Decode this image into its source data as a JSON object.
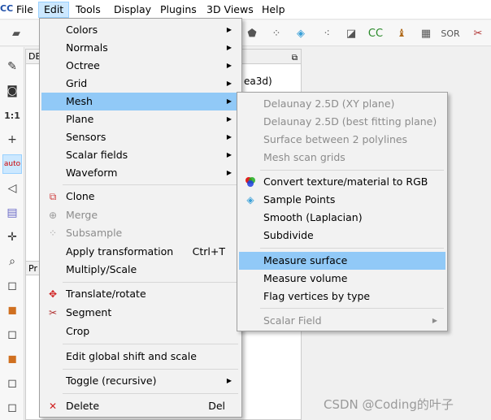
{
  "menubar": {
    "logo": "CC",
    "items": [
      "File",
      "Edit",
      "Tools",
      "Display",
      "Plugins",
      "3D Views",
      "Help"
    ]
  },
  "panel": {
    "db_title": "DB",
    "tree_fragment": "ea3d)",
    "props_title": "Pr"
  },
  "edit_menu": {
    "items": [
      {
        "label": "Colors"
      },
      {
        "label": "Normals"
      },
      {
        "label": "Octree"
      },
      {
        "label": "Grid"
      },
      {
        "label": "Mesh"
      },
      {
        "label": "Plane"
      },
      {
        "label": "Sensors"
      },
      {
        "label": "Scalar fields"
      },
      {
        "label": "Waveform"
      },
      {
        "label": "Clone"
      },
      {
        "label": "Merge"
      },
      {
        "label": "Subsample"
      },
      {
        "label": "Apply transformation",
        "shortcut": "Ctrl+T"
      },
      {
        "label": "Multiply/Scale"
      },
      {
        "label": "Translate/rotate"
      },
      {
        "label": "Segment"
      },
      {
        "label": "Crop"
      },
      {
        "label": "Edit global shift and scale"
      },
      {
        "label": "Toggle (recursive)"
      },
      {
        "label": "Delete",
        "shortcut": "Del"
      }
    ]
  },
  "mesh_menu": {
    "items": [
      {
        "label": "Delaunay 2.5D (XY plane)"
      },
      {
        "label": "Delaunay 2.5D (best fitting plane)"
      },
      {
        "label": "Surface between 2 polylines"
      },
      {
        "label": "Mesh scan grids"
      },
      {
        "label": "Convert texture/material to RGB"
      },
      {
        "label": "Sample Points"
      },
      {
        "label": "Smooth (Laplacian)"
      },
      {
        "label": "Subdivide"
      },
      {
        "label": "Measure surface"
      },
      {
        "label": "Measure volume"
      },
      {
        "label": "Flag vertices by type"
      },
      {
        "label": "Scalar Field"
      }
    ]
  },
  "watermark": "CSDN @Coding的叶子"
}
